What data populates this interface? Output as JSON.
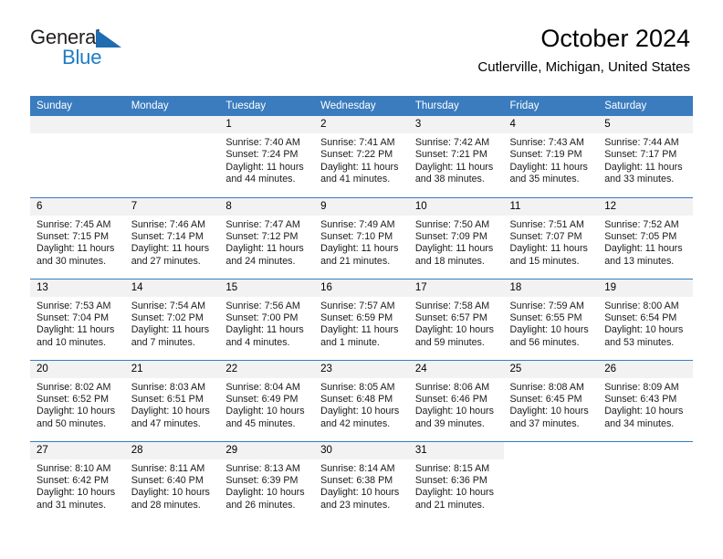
{
  "brand": {
    "name_part1": "General",
    "name_part2": "Blue",
    "triangle_color": "#1f6cb0",
    "blue_text_color": "#1f7cc4"
  },
  "header": {
    "title": "October 2024",
    "location": "Cutlerville, Michigan, United States"
  },
  "theme": {
    "header_row_bg": "#3a7cbe",
    "header_row_text": "#ffffff",
    "daynum_band_bg": "#f2f2f2",
    "row_divider": "#3a7cbe",
    "cell_bg": "#ffffff"
  },
  "weekday_headers": [
    "Sunday",
    "Monday",
    "Tuesday",
    "Wednesday",
    "Thursday",
    "Friday",
    "Saturday"
  ],
  "labels": {
    "sunrise_prefix": "Sunrise: ",
    "sunset_prefix": "Sunset: ",
    "daylight_prefix": "Daylight: "
  },
  "weeks": [
    [
      {
        "day": "",
        "empty": true
      },
      {
        "day": "",
        "empty": true
      },
      {
        "day": "1",
        "sunrise": "Sunrise: 7:40 AM",
        "sunset": "Sunset: 7:24 PM",
        "daylight": "Daylight: 11 hours and 44 minutes."
      },
      {
        "day": "2",
        "sunrise": "Sunrise: 7:41 AM",
        "sunset": "Sunset: 7:22 PM",
        "daylight": "Daylight: 11 hours and 41 minutes."
      },
      {
        "day": "3",
        "sunrise": "Sunrise: 7:42 AM",
        "sunset": "Sunset: 7:21 PM",
        "daylight": "Daylight: 11 hours and 38 minutes."
      },
      {
        "day": "4",
        "sunrise": "Sunrise: 7:43 AM",
        "sunset": "Sunset: 7:19 PM",
        "daylight": "Daylight: 11 hours and 35 minutes."
      },
      {
        "day": "5",
        "sunrise": "Sunrise: 7:44 AM",
        "sunset": "Sunset: 7:17 PM",
        "daylight": "Daylight: 11 hours and 33 minutes."
      }
    ],
    [
      {
        "day": "6",
        "sunrise": "Sunrise: 7:45 AM",
        "sunset": "Sunset: 7:15 PM",
        "daylight": "Daylight: 11 hours and 30 minutes."
      },
      {
        "day": "7",
        "sunrise": "Sunrise: 7:46 AM",
        "sunset": "Sunset: 7:14 PM",
        "daylight": "Daylight: 11 hours and 27 minutes."
      },
      {
        "day": "8",
        "sunrise": "Sunrise: 7:47 AM",
        "sunset": "Sunset: 7:12 PM",
        "daylight": "Daylight: 11 hours and 24 minutes."
      },
      {
        "day": "9",
        "sunrise": "Sunrise: 7:49 AM",
        "sunset": "Sunset: 7:10 PM",
        "daylight": "Daylight: 11 hours and 21 minutes."
      },
      {
        "day": "10",
        "sunrise": "Sunrise: 7:50 AM",
        "sunset": "Sunset: 7:09 PM",
        "daylight": "Daylight: 11 hours and 18 minutes."
      },
      {
        "day": "11",
        "sunrise": "Sunrise: 7:51 AM",
        "sunset": "Sunset: 7:07 PM",
        "daylight": "Daylight: 11 hours and 15 minutes."
      },
      {
        "day": "12",
        "sunrise": "Sunrise: 7:52 AM",
        "sunset": "Sunset: 7:05 PM",
        "daylight": "Daylight: 11 hours and 13 minutes."
      }
    ],
    [
      {
        "day": "13",
        "sunrise": "Sunrise: 7:53 AM",
        "sunset": "Sunset: 7:04 PM",
        "daylight": "Daylight: 11 hours and 10 minutes."
      },
      {
        "day": "14",
        "sunrise": "Sunrise: 7:54 AM",
        "sunset": "Sunset: 7:02 PM",
        "daylight": "Daylight: 11 hours and 7 minutes."
      },
      {
        "day": "15",
        "sunrise": "Sunrise: 7:56 AM",
        "sunset": "Sunset: 7:00 PM",
        "daylight": "Daylight: 11 hours and 4 minutes."
      },
      {
        "day": "16",
        "sunrise": "Sunrise: 7:57 AM",
        "sunset": "Sunset: 6:59 PM",
        "daylight": "Daylight: 11 hours and 1 minute."
      },
      {
        "day": "17",
        "sunrise": "Sunrise: 7:58 AM",
        "sunset": "Sunset: 6:57 PM",
        "daylight": "Daylight: 10 hours and 59 minutes."
      },
      {
        "day": "18",
        "sunrise": "Sunrise: 7:59 AM",
        "sunset": "Sunset: 6:55 PM",
        "daylight": "Daylight: 10 hours and 56 minutes."
      },
      {
        "day": "19",
        "sunrise": "Sunrise: 8:00 AM",
        "sunset": "Sunset: 6:54 PM",
        "daylight": "Daylight: 10 hours and 53 minutes."
      }
    ],
    [
      {
        "day": "20",
        "sunrise": "Sunrise: 8:02 AM",
        "sunset": "Sunset: 6:52 PM",
        "daylight": "Daylight: 10 hours and 50 minutes."
      },
      {
        "day": "21",
        "sunrise": "Sunrise: 8:03 AM",
        "sunset": "Sunset: 6:51 PM",
        "daylight": "Daylight: 10 hours and 47 minutes."
      },
      {
        "day": "22",
        "sunrise": "Sunrise: 8:04 AM",
        "sunset": "Sunset: 6:49 PM",
        "daylight": "Daylight: 10 hours and 45 minutes."
      },
      {
        "day": "23",
        "sunrise": "Sunrise: 8:05 AM",
        "sunset": "Sunset: 6:48 PM",
        "daylight": "Daylight: 10 hours and 42 minutes."
      },
      {
        "day": "24",
        "sunrise": "Sunrise: 8:06 AM",
        "sunset": "Sunset: 6:46 PM",
        "daylight": "Daylight: 10 hours and 39 minutes."
      },
      {
        "day": "25",
        "sunrise": "Sunrise: 8:08 AM",
        "sunset": "Sunset: 6:45 PM",
        "daylight": "Daylight: 10 hours and 37 minutes."
      },
      {
        "day": "26",
        "sunrise": "Sunrise: 8:09 AM",
        "sunset": "Sunset: 6:43 PM",
        "daylight": "Daylight: 10 hours and 34 minutes."
      }
    ],
    [
      {
        "day": "27",
        "sunrise": "Sunrise: 8:10 AM",
        "sunset": "Sunset: 6:42 PM",
        "daylight": "Daylight: 10 hours and 31 minutes."
      },
      {
        "day": "28",
        "sunrise": "Sunrise: 8:11 AM",
        "sunset": "Sunset: 6:40 PM",
        "daylight": "Daylight: 10 hours and 28 minutes."
      },
      {
        "day": "29",
        "sunrise": "Sunrise: 8:13 AM",
        "sunset": "Sunset: 6:39 PM",
        "daylight": "Daylight: 10 hours and 26 minutes."
      },
      {
        "day": "30",
        "sunrise": "Sunrise: 8:14 AM",
        "sunset": "Sunset: 6:38 PM",
        "daylight": "Daylight: 10 hours and 23 minutes."
      },
      {
        "day": "31",
        "sunrise": "Sunrise: 8:15 AM",
        "sunset": "Sunset: 6:36 PM",
        "daylight": "Daylight: 10 hours and 21 minutes."
      },
      {
        "day": "",
        "blank": true
      },
      {
        "day": "",
        "blank": true
      }
    ]
  ]
}
